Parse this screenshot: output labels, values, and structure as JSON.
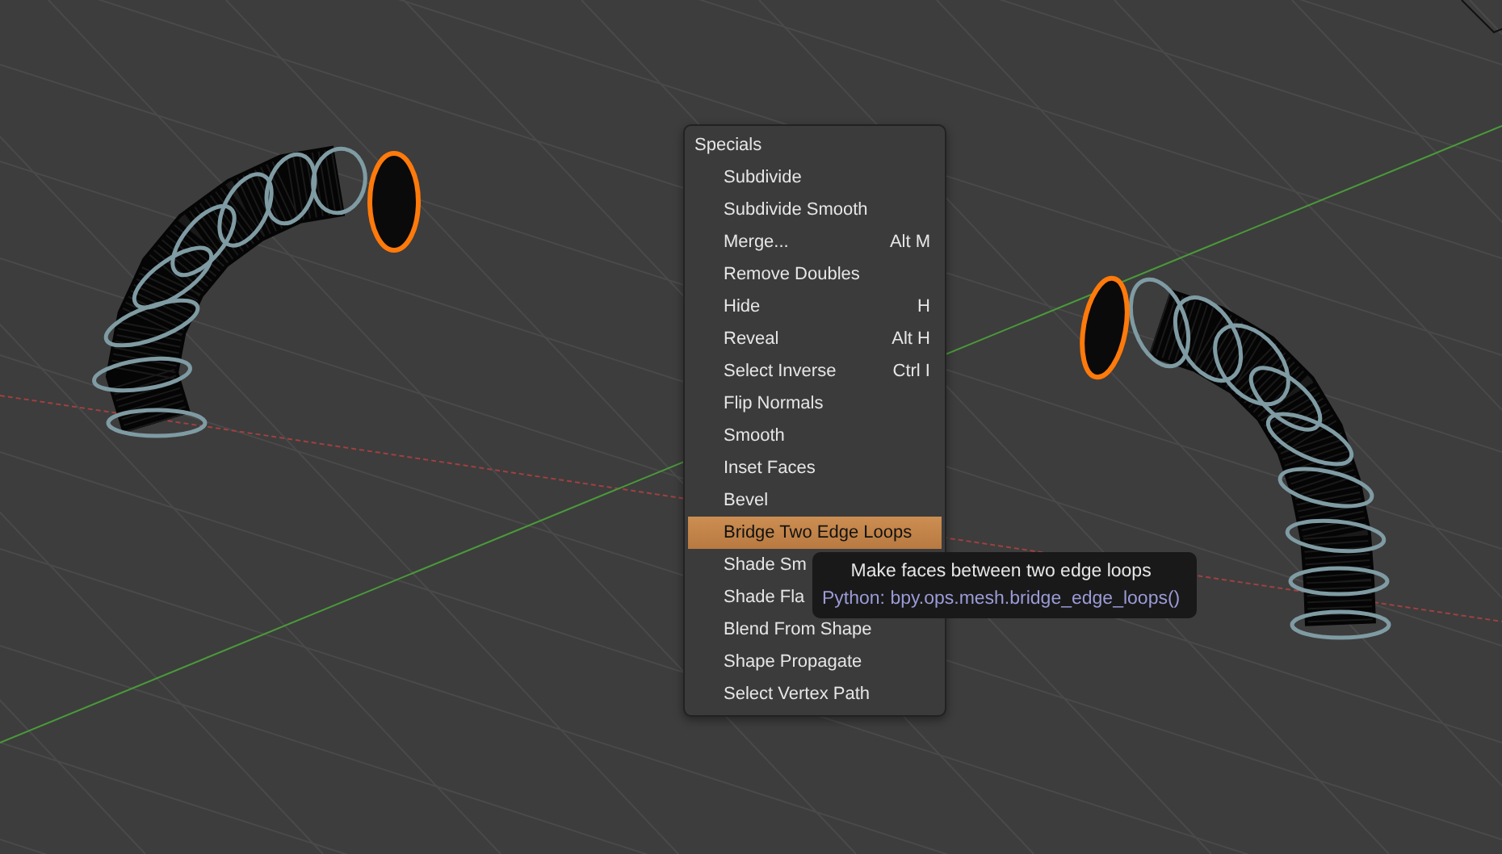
{
  "menu": {
    "title": "Specials",
    "items": [
      {
        "label": "Subdivide",
        "selected": false
      },
      {
        "label": "Subdivide Smooth",
        "selected": false
      },
      {
        "label": "Merge...",
        "shortcut": "Alt M",
        "selected": false
      },
      {
        "label": "Remove Doubles",
        "selected": false
      },
      {
        "label": "Hide",
        "shortcut": "H",
        "selected": false
      },
      {
        "label": "Reveal",
        "shortcut": "Alt H",
        "selected": false
      },
      {
        "label": "Select Inverse",
        "shortcut": "Ctrl I",
        "selected": false
      },
      {
        "label": "Flip Normals",
        "selected": false
      },
      {
        "label": "Smooth",
        "selected": false
      },
      {
        "label": "Inset Faces",
        "selected": false
      },
      {
        "label": "Bevel",
        "selected": false
      },
      {
        "label": "Bridge Two Edge Loops",
        "selected": true
      },
      {
        "label": "Shade Sm",
        "selected": false
      },
      {
        "label": "Shade Fla",
        "selected": false
      },
      {
        "label": "Blend From Shape",
        "selected": false
      },
      {
        "label": "Shape Propagate",
        "selected": false
      },
      {
        "label": "Select Vertex Path",
        "selected": false
      }
    ]
  },
  "tooltip": {
    "description": "Make faces between two edge loops",
    "python": "Python: bpy.ops.mesh.bridge_edge_loops()"
  }
}
